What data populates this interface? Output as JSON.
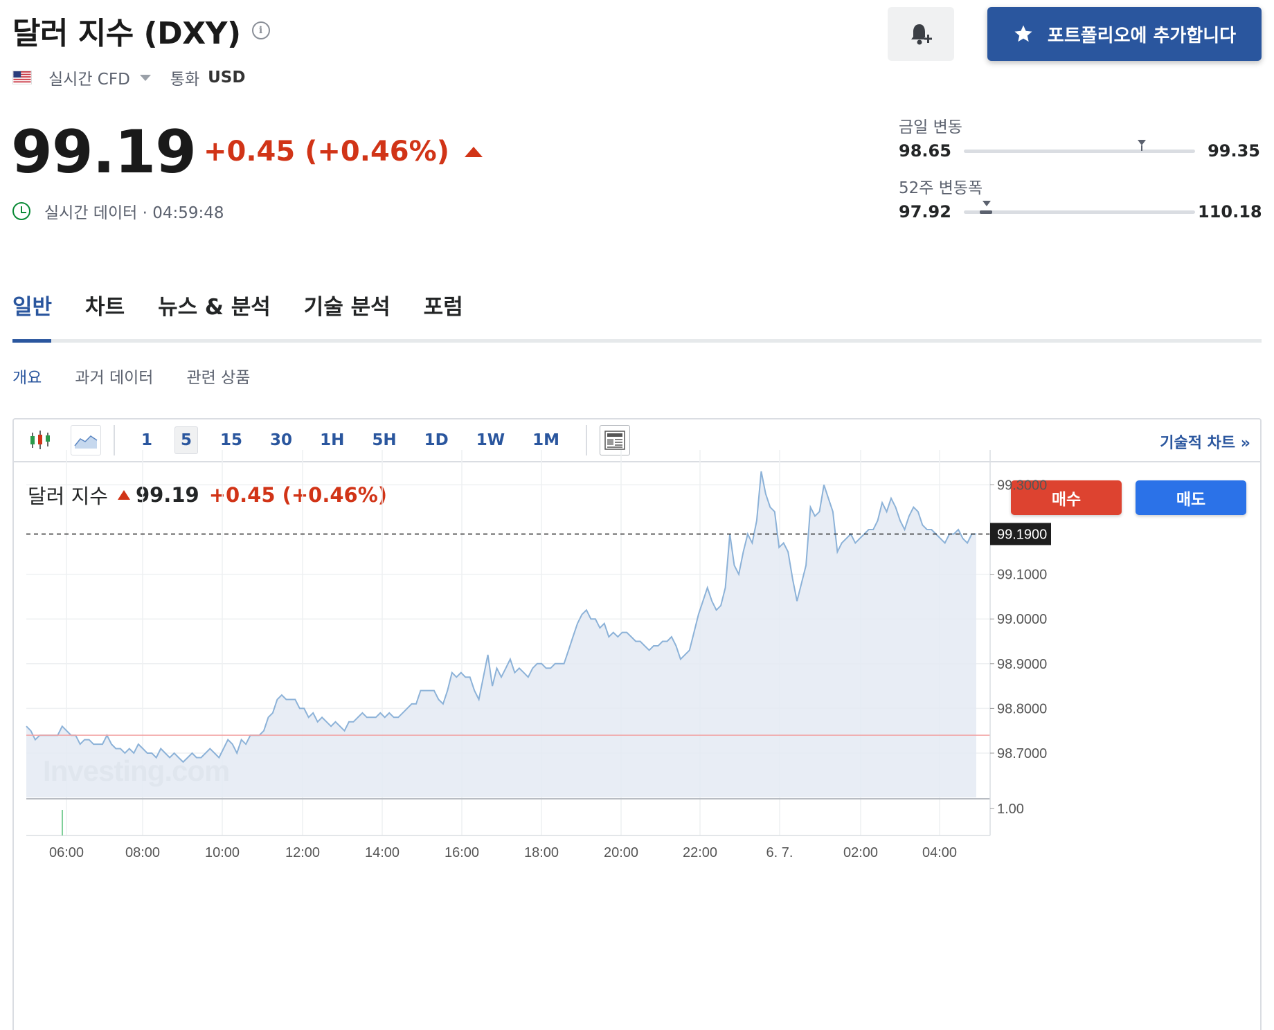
{
  "header": {
    "title": "달러 지수 (DXY)",
    "info_icon": "info-icon",
    "market_type": "실시간 CFD",
    "currency_label": "통화",
    "currency_value": "USD",
    "alert_icon": "bell-plus-icon",
    "portfolio_button": "포트폴리오에 추가합니다"
  },
  "quote": {
    "price": "99.19",
    "change": "+0.45 (+0.46%)",
    "realtime_label": "실시간 데이터 · 04:59:48",
    "up_color": "#d13417"
  },
  "ranges": {
    "day": {
      "label": "금일 변동",
      "low": "98.65",
      "high": "99.35",
      "position": 0.77
    },
    "week52": {
      "label": "52주 변동폭",
      "low": "97.92",
      "high": "110.18",
      "position": 0.1
    }
  },
  "tabs": [
    "일반",
    "차트",
    "뉴스 & 분석",
    "기술 분석",
    "포럼"
  ],
  "active_tab": 0,
  "subtabs": [
    "개요",
    "과거 데이터",
    "관련 상품"
  ],
  "active_subtab": 0,
  "toolbar": {
    "intervals": [
      "1",
      "5",
      "15",
      "30",
      "1H",
      "5H",
      "1D",
      "1W",
      "1M"
    ],
    "active_interval": "5",
    "tech_chart_link": "기술적 차트 »"
  },
  "chart_header": {
    "name": "달러 지수",
    "price": "99.19",
    "change": "+0.45 (+0.46%)"
  },
  "buttons": {
    "buy": "매수",
    "sell": "매도"
  },
  "chart_data": {
    "type": "area",
    "x_ticks": [
      "06:00",
      "08:00",
      "10:00",
      "12:00",
      "14:00",
      "16:00",
      "18:00",
      "20:00",
      "22:00",
      "6. 7.",
      "02:00",
      "04:00"
    ],
    "y_ticks": [
      "99.3000",
      "99.1000",
      "99.0000",
      "98.9000",
      "98.8000",
      "98.7000"
    ],
    "ylim": [
      98.6,
      99.37
    ],
    "current_price_label": "99.1900",
    "current_price": 99.19,
    "previous_close": 98.74,
    "volume_tick": "1.00",
    "watermark": "Investing.com",
    "series": [
      {
        "values": [
          98.76,
          98.75,
          98.73,
          98.74,
          98.74,
          98.74,
          98.74,
          98.74,
          98.76,
          98.75,
          98.74,
          98.74,
          98.72,
          98.73,
          98.73,
          98.72,
          98.72,
          98.72,
          98.74,
          98.72,
          98.71,
          98.71,
          98.7,
          98.71,
          98.7,
          98.72,
          98.71,
          98.7,
          98.7,
          98.69,
          98.71,
          98.7,
          98.69,
          98.7,
          98.69,
          98.68,
          98.69,
          98.7,
          98.69,
          98.69,
          98.7,
          98.71,
          98.7,
          98.69,
          98.71,
          98.73,
          98.72,
          98.7,
          98.73,
          98.72,
          98.74,
          98.74,
          98.74,
          98.75,
          98.78,
          98.79,
          98.82,
          98.83,
          98.82,
          98.82,
          98.82,
          98.8,
          98.8,
          98.78,
          98.79,
          98.77,
          98.78,
          98.77,
          98.76,
          98.77,
          98.76,
          98.75,
          98.77,
          98.77,
          98.78,
          98.79,
          98.78,
          98.78,
          98.78,
          98.79,
          98.78,
          98.79,
          98.78,
          98.78,
          98.79,
          98.8,
          98.81,
          98.81,
          98.84,
          98.84,
          98.84,
          98.84,
          98.82,
          98.81,
          98.84,
          98.88,
          98.87,
          98.88,
          98.87,
          98.87,
          98.84,
          98.82,
          98.87,
          98.92,
          98.85,
          98.89,
          98.87,
          98.89,
          98.91,
          98.88,
          98.89,
          98.88,
          98.87,
          98.89,
          98.9,
          98.9,
          98.89,
          98.89,
          98.9,
          98.9,
          98.9,
          98.93,
          98.96,
          98.99,
          99.01,
          99.02,
          99.0,
          99.0,
          98.98,
          98.99,
          98.96,
          98.97,
          98.96,
          98.97,
          98.97,
          98.96,
          98.95,
          98.95,
          98.94,
          98.93,
          98.94,
          98.94,
          98.95,
          98.95,
          98.96,
          98.94,
          98.91,
          98.92,
          98.93,
          98.97,
          99.01,
          99.04,
          99.07,
          99.04,
          99.02,
          99.03,
          99.07,
          99.19,
          99.12,
          99.1,
          99.15,
          99.19,
          99.17,
          99.22,
          99.33,
          99.28,
          99.25,
          99.24,
          99.16,
          99.17,
          99.15,
          99.09,
          99.04,
          99.08,
          99.12,
          99.25,
          99.23,
          99.24,
          99.3,
          99.27,
          99.24,
          99.15,
          99.17,
          99.18,
          99.19,
          99.17,
          99.18,
          99.19,
          99.2,
          99.2,
          99.22,
          99.26,
          99.24,
          99.27,
          99.25,
          99.22,
          99.2,
          99.23,
          99.25,
          99.24,
          99.21,
          99.2,
          99.2,
          99.19,
          99.18,
          99.17,
          99.19,
          99.19,
          99.2,
          99.18,
          99.17,
          99.19,
          99.19
        ]
      }
    ]
  }
}
